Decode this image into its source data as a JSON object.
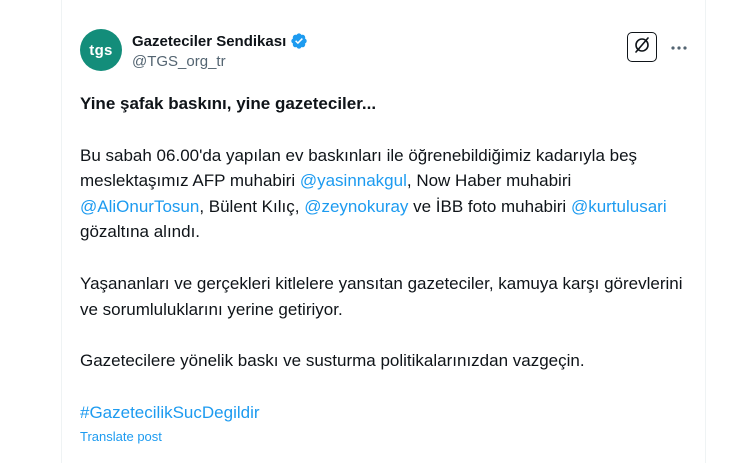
{
  "author": {
    "avatar_text": "tgs",
    "display_name": "Gazeteciler Sendikası",
    "handle": "@TGS_org_tr"
  },
  "icons": {
    "verified": "verified-badge-icon",
    "grok": "grok-icon",
    "more": "more-options-icon"
  },
  "colors": {
    "avatar_bg": "#138d7a",
    "link": "#1d9bf0",
    "verified": "#1d9bf0",
    "text": "#0f1419",
    "secondary": "#536471"
  },
  "tweet": {
    "title": "Yine şafak baskını, yine gazeteciler...",
    "p1_a": "Bu sabah 06.00'da yapılan ev baskınları ile öğrenebildiğimiz kadarıyla beş meslektaşımız AFP muhabiri ",
    "mention_1": "@yasinnakgul",
    "p1_b": ", Now Haber muhabiri ",
    "mention_2": "@AliOnurTosun",
    "p1_c": ", Bülent Kılıç, ",
    "mention_3": "@zeynokuray",
    "p1_d": " ve İBB foto muhabiri ",
    "mention_4": "@kurtulusari",
    "p1_e": " gözaltına alındı.",
    "p2": "Yaşananları ve gerçekleri kitlelere yansıtan gazeteciler, kamuya karşı görevlerini ve sorumluluklarını yerine getiriyor.",
    "p3": "Gazetecilere yönelik baskı ve susturma politikalarınızdan vazgeçin.",
    "hashtag": "#GazetecilikSucDegildir",
    "translate_label": "Translate post"
  }
}
